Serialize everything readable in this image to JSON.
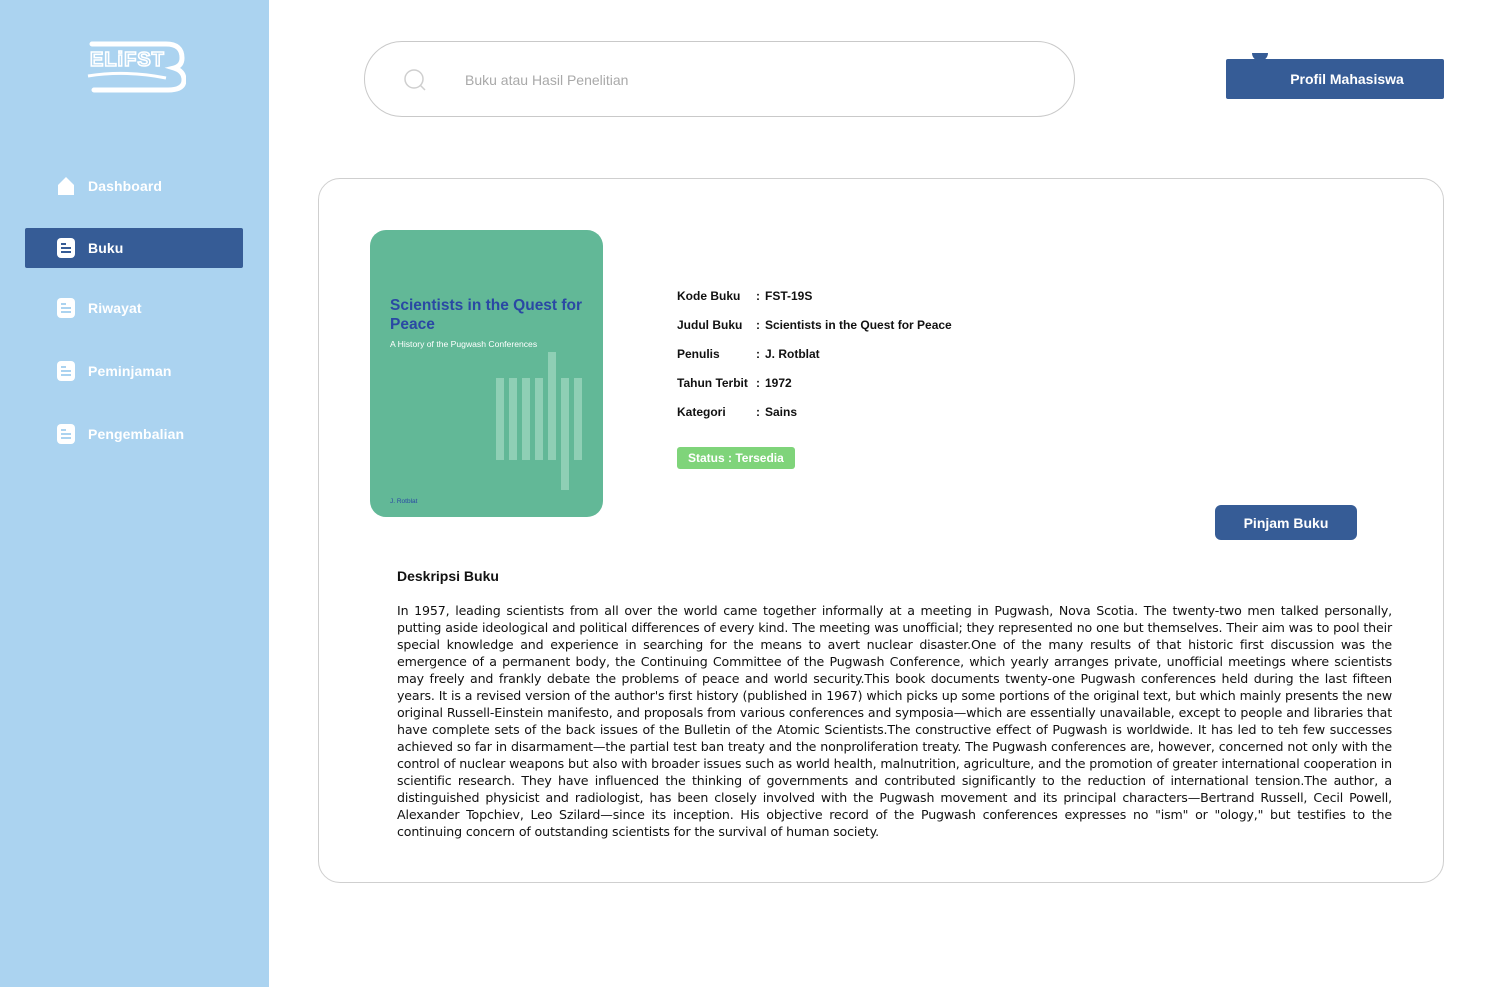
{
  "app": {
    "logo_text": "ELiFST"
  },
  "sidebar": {
    "items": [
      {
        "label": "Dashboard",
        "icon": "home-icon",
        "active": false
      },
      {
        "label": "Buku",
        "icon": "document-icon",
        "active": true
      },
      {
        "label": "Riwayat",
        "icon": "document-icon",
        "active": false
      },
      {
        "label": "Peminjaman",
        "icon": "document-icon",
        "active": false
      },
      {
        "label": "Pengembalian",
        "icon": "document-icon",
        "active": false
      }
    ]
  },
  "search": {
    "placeholder": "Buku atau Hasil Penelitian",
    "value": ""
  },
  "header": {
    "profile_label": "Profil Mahasiswa"
  },
  "book": {
    "cover": {
      "title": "Scientists in the Quest for Peace",
      "subtitle": "A History of the Pugwash Conferences",
      "author": "J. Rotblat"
    },
    "fields": [
      {
        "key": "Kode Buku",
        "value": "FST-19S"
      },
      {
        "key": "Judul Buku",
        "value": "Scientists in the Quest for Peace"
      },
      {
        "key": "Penulis",
        "value": "J. Rotblat"
      },
      {
        "key": "Tahun Terbit",
        "value": "1972"
      },
      {
        "key": "Kategori",
        "value": "Sains"
      }
    ],
    "status": "Status : Tersedia",
    "borrow_label": "Pinjam Buku",
    "description_title": "Deskripsi Buku",
    "description": "In 1957, leading scientists from all over the world came together informally at a meeting in Pugwash, Nova Scotia. The twenty-two men talked personally, putting aside ideological and political differences of every kind. The meeting was unofficial; they represented no one but themselves. Their aim was to pool their special knowledge and experience in searching for the means to avert nuclear disaster.One of the many results of that historic first discussion was the emergence of a permanent body, the Continuing Committee of the Pugwash Conference, which yearly arranges private, unofficial meetings where scientists may freely and frankly debate the problems of peace and world security.This book documents twenty-one Pugwash conferences held during the last fifteen years. It is a revised version of the author's first history (published in 1967) which picks up some portions of the original text, but which mainly presents the new original Russell-Einstein manifesto, and proposals from various conferences and symposia—which are essentially unavailable, except to people and libraries that have complete sets of the back issues of the Bulletin of the Atomic Scientists.The constructive effect of Pugwash is worldwide. It has led to teh few successes achieved so far in disarmament—the partial test ban treaty and the nonproliferation treaty. The Pugwash conferences are, however, concerned not only with the control of nuclear weapons but also with broader issues such as world health, malnutrition, agriculture, and the promotion of greater international cooperation in scientific research. They have influenced the thinking of governments and contributed significantly to the reduction of international tension.The author, a distinguished physicist and radiologist, has been closely involved with the Pugwash movement and its principal characters—Bertrand Russell, Cecil Powell, Alexander Topchiev, Leo Szilard—since its inception. His objective record of the Pugwash conferences expresses no \"ism\" or \"ology,\" but testifies to the continuing concern of outstanding scientists for the survival of human society."
  },
  "colors": {
    "sidebar_bg": "#abd3f0",
    "accent": "#365c96",
    "cover_bg": "#62b897",
    "status_bg": "#7fd47a"
  }
}
